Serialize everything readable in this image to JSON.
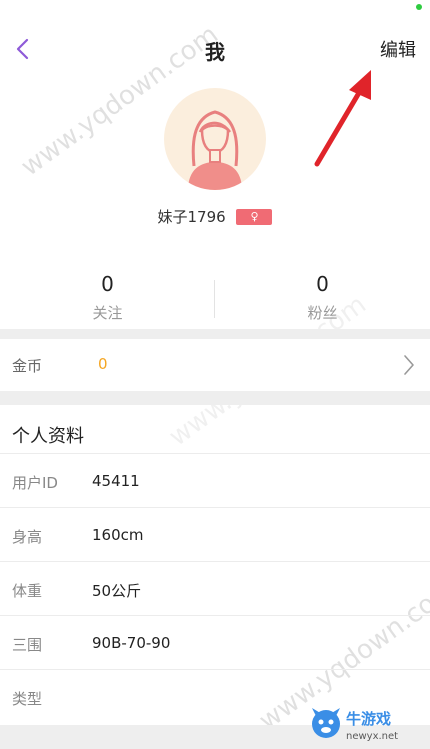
{
  "header": {
    "title": "我",
    "edit_label": "编辑"
  },
  "profile": {
    "username": "妹子1796",
    "gender_symbol": "♀"
  },
  "stats": [
    {
      "count": "0",
      "label": "关注"
    },
    {
      "count": "0",
      "label": "粉丝"
    }
  ],
  "coins": {
    "label": "金币",
    "value": "0"
  },
  "personal_info": {
    "title": "个人资料",
    "fields": [
      {
        "key": "用户ID",
        "value": "45411"
      },
      {
        "key": "身高",
        "value": "160cm"
      },
      {
        "key": "体重",
        "value": "50公斤"
      },
      {
        "key": "三围",
        "value": "90B-70-90"
      },
      {
        "key": "类型",
        "value": ""
      }
    ]
  },
  "watermarks": [
    "www.yqdown.com",
    "www.yqdown.com",
    "www.yqdown.com"
  ],
  "logo": {
    "name": "牛游戏",
    "url_text": "newyx.net"
  },
  "colors": {
    "accent_purple": "#8e5ad8",
    "badge_red": "#f06b74",
    "coin_orange": "#f5a623",
    "arrow_red": "#e0242a"
  }
}
